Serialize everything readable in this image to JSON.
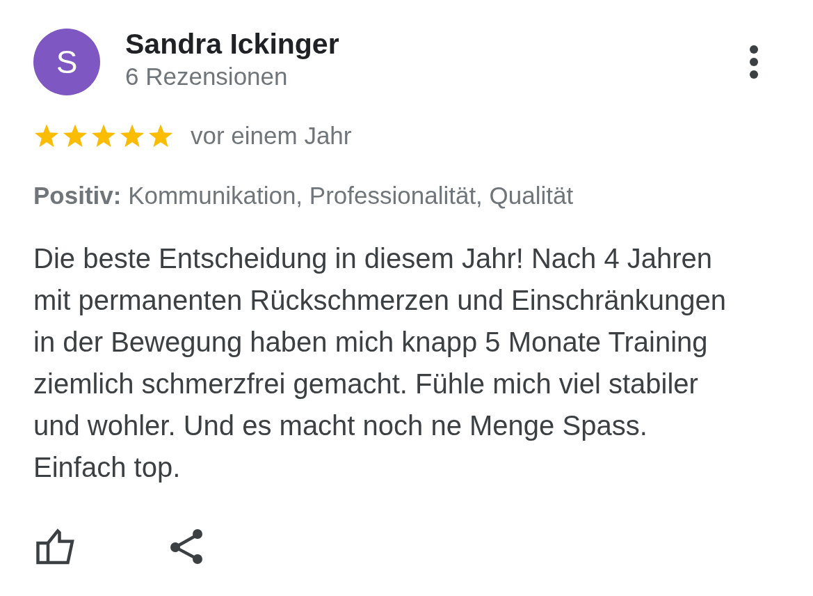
{
  "review": {
    "author": {
      "initial": "S",
      "name": "Sandra Ickinger",
      "subtitle": "6 Rezensionen"
    },
    "stars": 5,
    "time": "vor einem Jahr",
    "highlights": "**Positiv:** Kommunikation, Professionalität, Qualität",
    "text": "Die beste Entscheidung in diesem Jahr! Nach 4 Jahren mit permanenten Rückschmerzen und Einschränkungen in der Bewegung haben mich knapp 5 Monate Training ziemlich schmerzfrei gemacht. Fühle mich viel stabiler und wohler. Und es macht noch ne Menge Spass. Einfach top."
  }
}
